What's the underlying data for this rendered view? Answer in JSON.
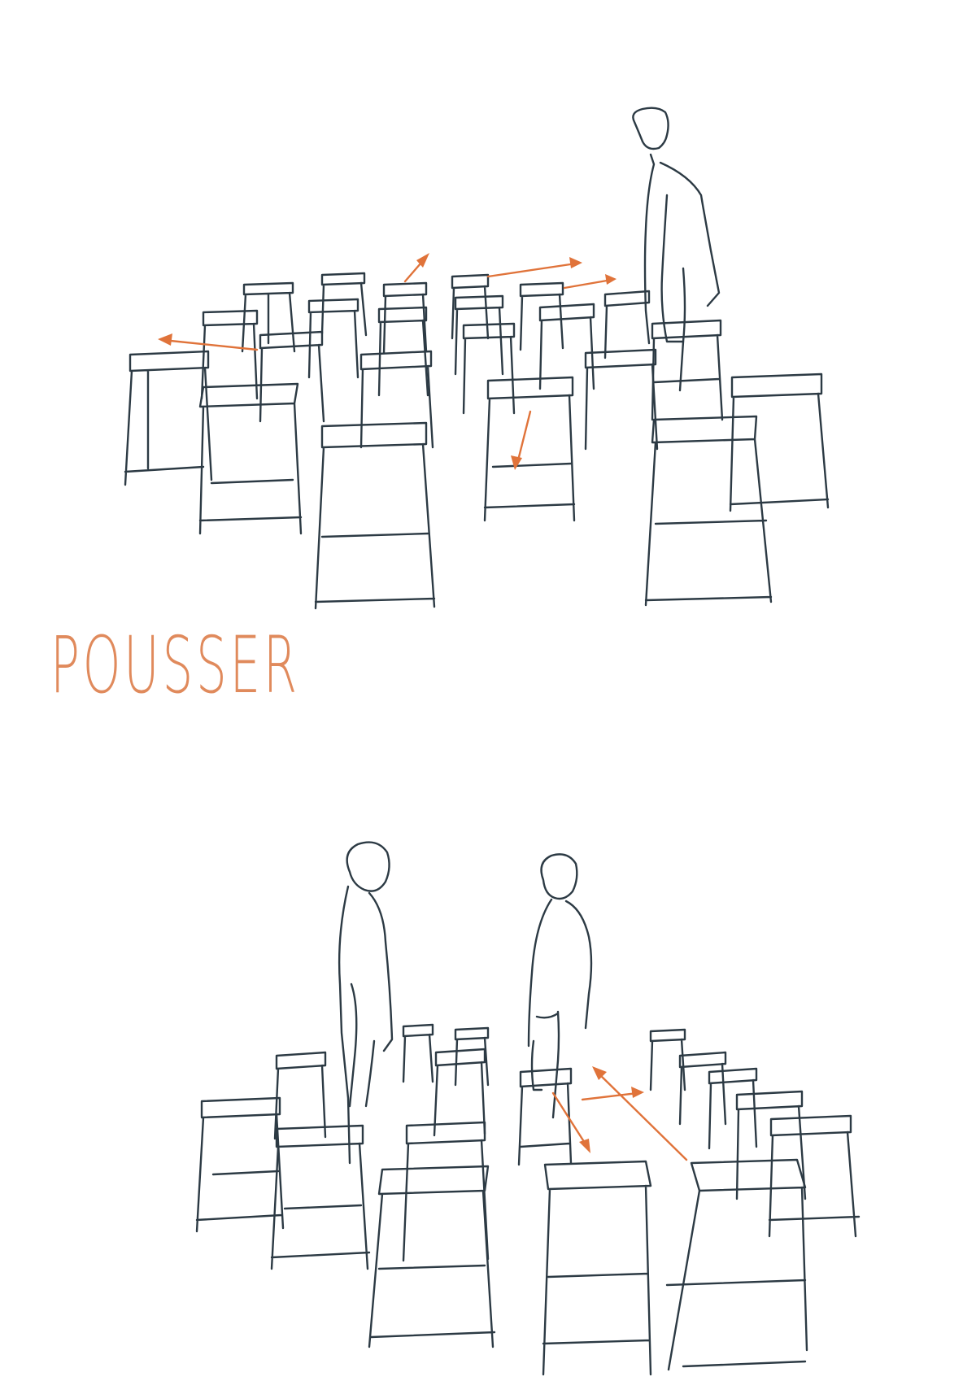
{
  "caption": {
    "title": "POUSSER"
  },
  "colors": {
    "ink": "#2c3a44",
    "accent": "#e0733a",
    "title": "#e08a5c",
    "background": "#ffffff"
  }
}
